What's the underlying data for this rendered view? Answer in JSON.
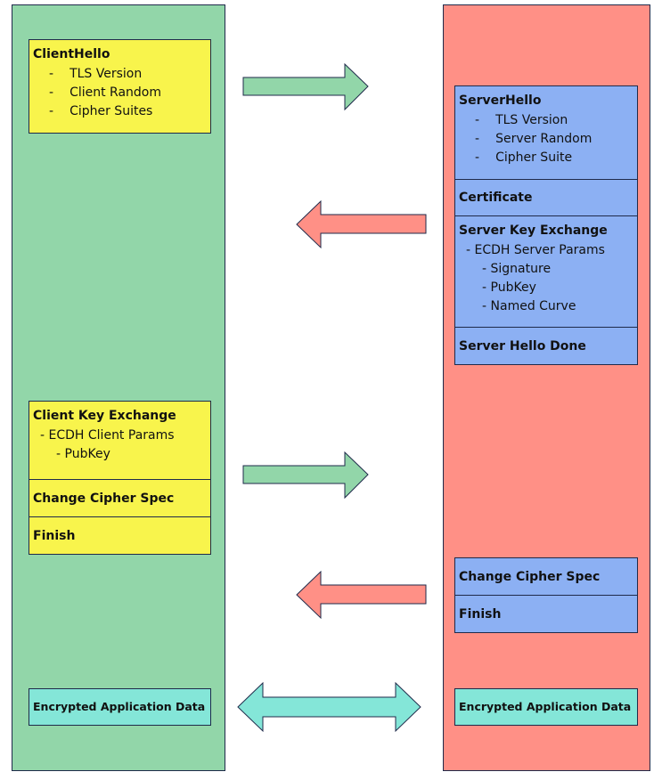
{
  "colors": {
    "client": "#92d6a9",
    "server": "#ff9086",
    "client_msg": "#f8f44c",
    "server_msg": "#8cb0f3",
    "app_data": "#84e6d8",
    "to_server_arrow": "#92d6a9",
    "to_client_arrow": "#ff9086",
    "bidirectional_arrow": "#84e6d8"
  },
  "client": {
    "client_hello": {
      "title": "ClientHello",
      "items": [
        "TLS Version",
        "Client Random",
        "Cipher Suites"
      ]
    },
    "client_key_exchange": {
      "title": "Client Key Exchange",
      "params": "ECDH Client Params",
      "sub": [
        "PubKey"
      ]
    },
    "change_cipher_spec": "Change Cipher Spec",
    "finish": "Finish",
    "app_data": "Encrypted Application Data"
  },
  "server": {
    "server_hello": {
      "title": "ServerHello",
      "items": [
        "TLS Version",
        "Server Random",
        "Cipher Suite"
      ]
    },
    "certificate": "Certificate",
    "server_key_exchange": {
      "title": "Server Key Exchange",
      "params": "ECDH Server Params",
      "sub": [
        "Signature",
        "PubKey",
        "Named Curve"
      ]
    },
    "server_hello_done": "Server Hello Done",
    "change_cipher_spec": "Change Cipher Spec",
    "finish": "Finish",
    "app_data": "Encrypted Application Data"
  },
  "bullet": "-"
}
